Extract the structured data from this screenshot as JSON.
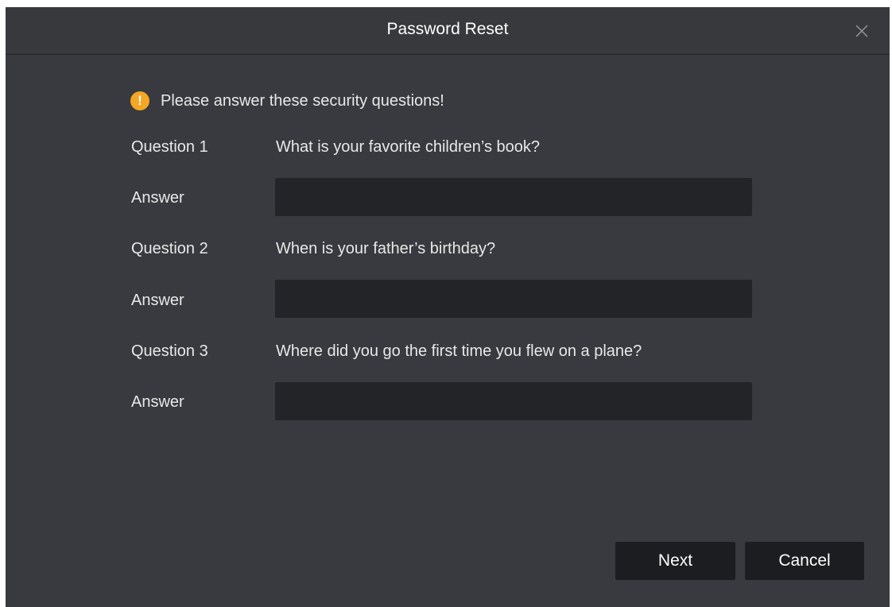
{
  "dialog": {
    "title": "Password Reset",
    "close_icon": "close-icon"
  },
  "notice": {
    "icon": "warning-icon",
    "icon_color": "#f5a623",
    "text": "Please answer these security questions!"
  },
  "questions": [
    {
      "label": "Question 1",
      "text": "What is your favorite children’s book?",
      "answer_label": "Answer",
      "answer_value": ""
    },
    {
      "label": "Question 2",
      "text": "When is your father’s birthday?",
      "answer_label": "Answer",
      "answer_value": ""
    },
    {
      "label": "Question 3",
      "text": "Where did you go the first time you flew on a plane?",
      "answer_label": "Answer",
      "answer_value": ""
    }
  ],
  "buttons": {
    "next_label": "Next",
    "cancel_label": "Cancel"
  }
}
